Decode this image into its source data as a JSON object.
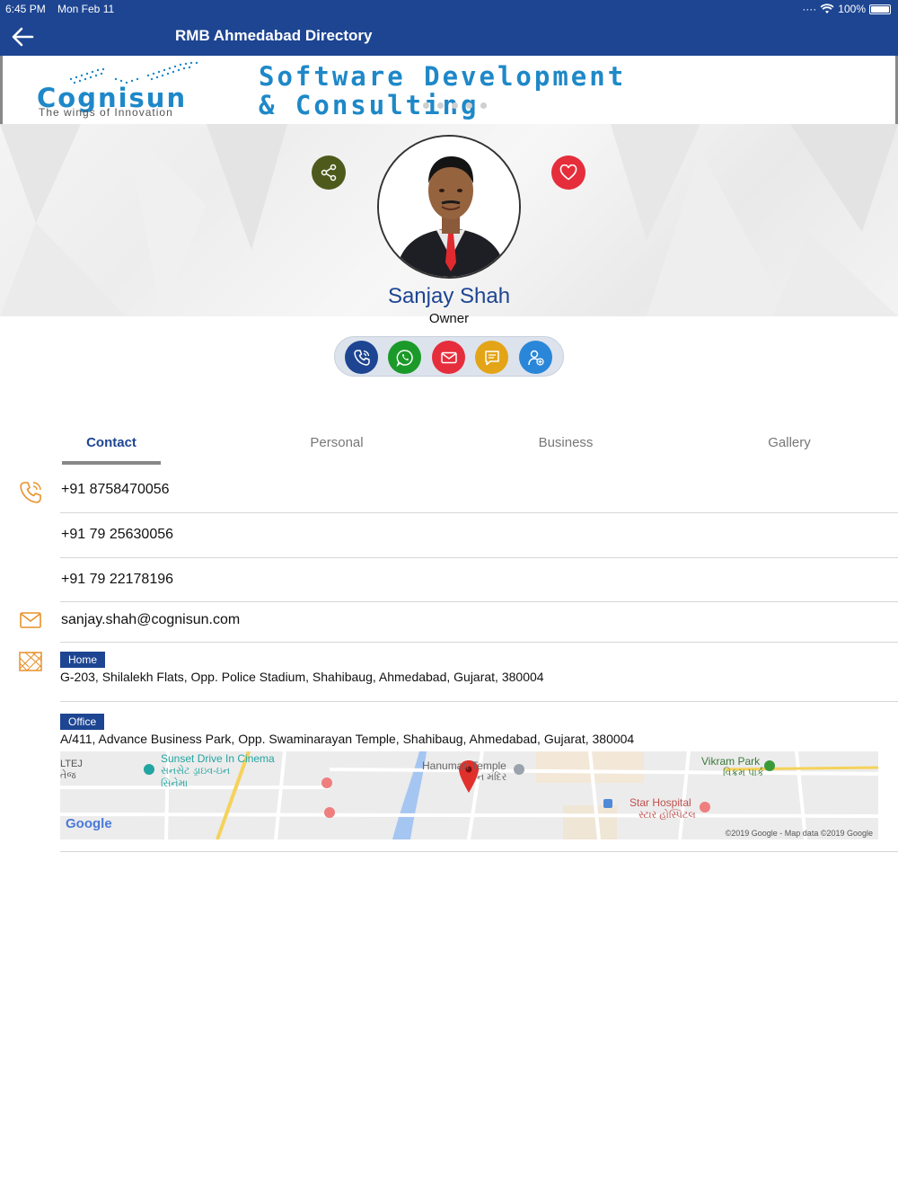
{
  "status": {
    "time": "6:45 PM",
    "date": "Mon Feb 11",
    "battery": "100%"
  },
  "nav": {
    "title": "RMB Ahmedabad Directory"
  },
  "banner": {
    "logo_word": "Cognisun",
    "logo_tagline": "The wings of Innovation",
    "headline_line1": "Software Development",
    "headline_line2": "& Consulting"
  },
  "profile": {
    "name": "Sanjay Shah",
    "role": "Owner"
  },
  "tabs": [
    {
      "label": "Contact"
    },
    {
      "label": "Personal"
    },
    {
      "label": "Business"
    },
    {
      "label": "Gallery"
    }
  ],
  "contact": {
    "phones": [
      "+91 8758470056",
      "+91 79 25630056",
      "+91 79 22178196"
    ],
    "email": "sanjay.shah@cognisun.com",
    "addresses": [
      {
        "tag": "Home",
        "text": "G-203, Shilalekh Flats, Opp. Police Stadium, Shahibaug, Ahmedabad, Gujarat, 380004"
      },
      {
        "tag": "Office",
        "text": "A/411, Advance Business Park, Opp. Swaminarayan Temple, Shahibaug, Ahmedabad, Gujarat, 380004"
      }
    ]
  },
  "map": {
    "label_altej": "LTEJ",
    "label_altej_gu": "તેજ",
    "label_cinema": "Sunset Drive In Cinema",
    "label_cinema_gu1": "સનસેટ ડ્રાઇવ-ઇન",
    "label_cinema_gu2": "સિનેમા",
    "label_temple": "Hanuman Temple",
    "label_temple_gu": "ન મંદિર",
    "label_vikram": "Vikram Park",
    "label_vikram_gu": "વિક્રમ પાર્ક",
    "label_hospital": "Star Hospital",
    "label_hospital_gu": "સ્ટાર હોસ્પિટલ",
    "google": "Google",
    "copyright": "©2019 Google - Map data ©2019 Google"
  },
  "colors": {
    "primary": "#1d4592",
    "call": "#1d4592",
    "whatsapp": "#1b9a2a",
    "mail": "#e62d3b",
    "message": "#e3a417",
    "addcontact": "#2a86d8",
    "accent_icon": "#e8912a"
  }
}
